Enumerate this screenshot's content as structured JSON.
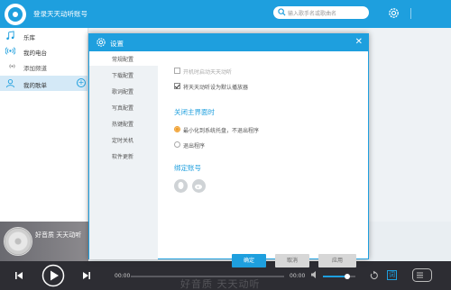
{
  "header": {
    "title": "登录天天动听账号",
    "search_placeholder": "输入歌手名或歌曲名"
  },
  "sidebar": {
    "items": [
      {
        "label": "乐库",
        "icon": "music-note-icon"
      },
      {
        "label": "我的电台",
        "icon": "radio-icon"
      },
      {
        "label": "添加频道",
        "icon": "radio-small-icon"
      },
      {
        "label": "我的歌单",
        "icon": "user-icon",
        "active": true
      }
    ]
  },
  "now_playing": {
    "text": "好音质 天天动听"
  },
  "player": {
    "current_time": "00:00",
    "total_time": "00:00",
    "volume": 0.75,
    "background_text": "好音质 天天动听"
  },
  "dialog": {
    "title": "设置",
    "nav": [
      "常规配置",
      "下载配置",
      "歌词配置",
      "写真配置",
      "热键配置",
      "定时关机",
      "软件更新"
    ],
    "active_nav": 0,
    "startup_option": "开机时启动天天动听",
    "default_player_option": "将天天动听设为默认播放器",
    "close_section_title": "关闭主界面时",
    "close_options": [
      "最小化到系统托盘，不退出程序",
      "退出程序"
    ],
    "bind_section_title": "绑定账号",
    "bind_icons": [
      "qq-icon",
      "weibo-icon"
    ],
    "buttons": {
      "ok": "确定",
      "cancel": "取消",
      "apply": "应用"
    }
  },
  "colors": {
    "accent": "#1e9fde",
    "player_bg": "#2d2d33",
    "radio_selected": "#f0a030"
  }
}
